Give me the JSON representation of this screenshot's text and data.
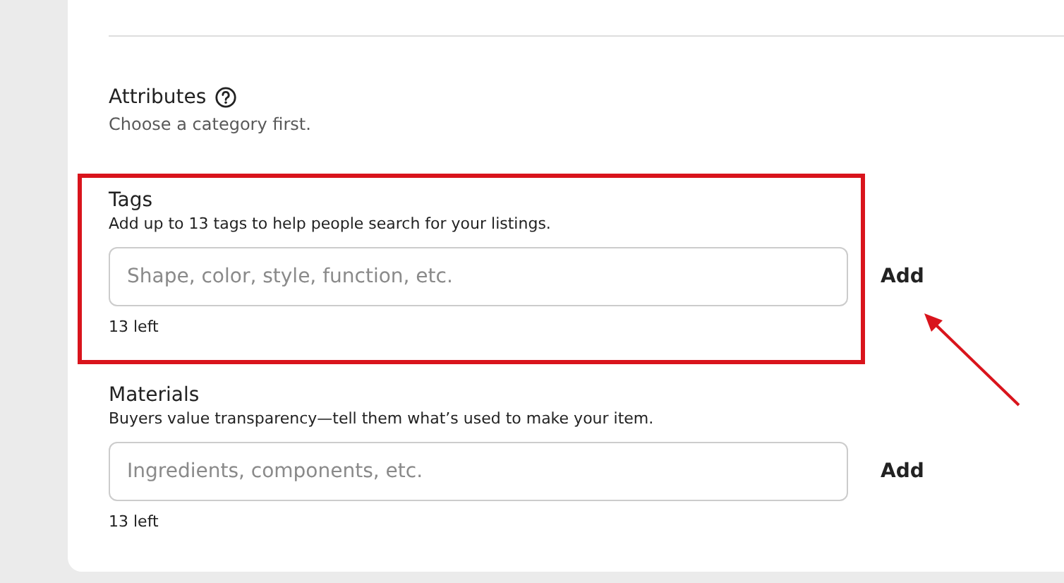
{
  "attributes": {
    "title": "Attributes",
    "hint": "Choose a category first."
  },
  "fields": [
    {
      "title": "Tags",
      "description": "Add up to 13 tags to help people search for your listings.",
      "placeholder": "Shape, color, style, function, etc.",
      "button": "Add",
      "remaining": "13 left",
      "highlighted": true
    },
    {
      "title": "Materials",
      "description": "Buyers value transparency—tell them what’s used to make your item.",
      "placeholder": "Ingredients, components, etc.",
      "button": "Add",
      "remaining": "13 left",
      "highlighted": false
    }
  ]
}
